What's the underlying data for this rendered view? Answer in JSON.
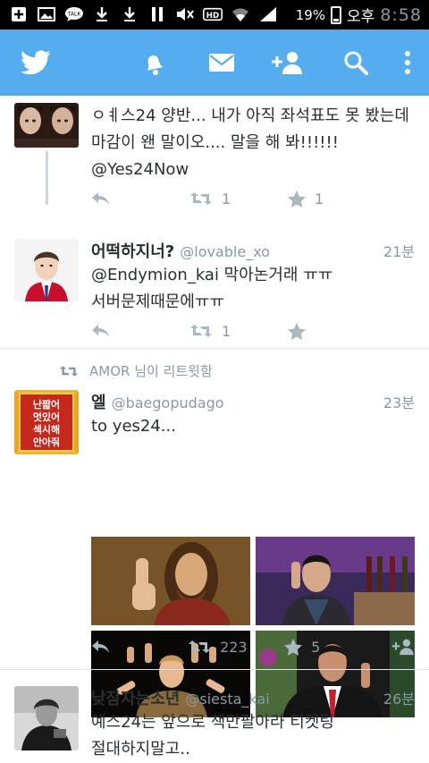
{
  "status_bar": {
    "battery": "19%",
    "ampm": "오후",
    "time": "8:58"
  },
  "app_bar": {
    "icons": [
      "twitter-bird-icon",
      "notifications-bell-icon",
      "messages-envelope-icon",
      "add-user-icon",
      "search-icon",
      "overflow-menu-icon"
    ]
  },
  "tweets": [
    {
      "text": "ㅇㅖ스24 양반... 내가 아직 좌석표도 못 봤는데 마감이 왠 말이오.... 말을 해 봐!!!!!!",
      "mention": "@Yes24Now",
      "retweets": "1",
      "favorites": "1"
    },
    {
      "name": "어떡하지너?",
      "handle": "@lovable_xo",
      "time": "21분",
      "line1": "@Endymion_kai 막아논거래 ㅠㅠ",
      "line2": "서버문제때문에ㅠㅠ",
      "retweets": "1"
    },
    {
      "retweet_note": "AMOR 님이 리트윗함",
      "name": "엘",
      "handle": "@baegopudago",
      "time": "23분",
      "text": "to yes24...",
      "avatar_text": [
        "난짧어",
        "멋있어",
        "섹시해",
        "안아줘"
      ],
      "retweets": "223",
      "favorites": "5"
    },
    {
      "name": "낮잠자는소년",
      "handle": "@siesta_kai",
      "time": "26분",
      "line1": "예스24는 앞으로 책만팔아라 티켓팅",
      "line2": "절대하지말고.."
    }
  ],
  "colors": {
    "twitter_blue": "#55acee",
    "meta_gray": "#8899a6",
    "text_dark": "#292f33",
    "divider": "#e1e8ed"
  }
}
